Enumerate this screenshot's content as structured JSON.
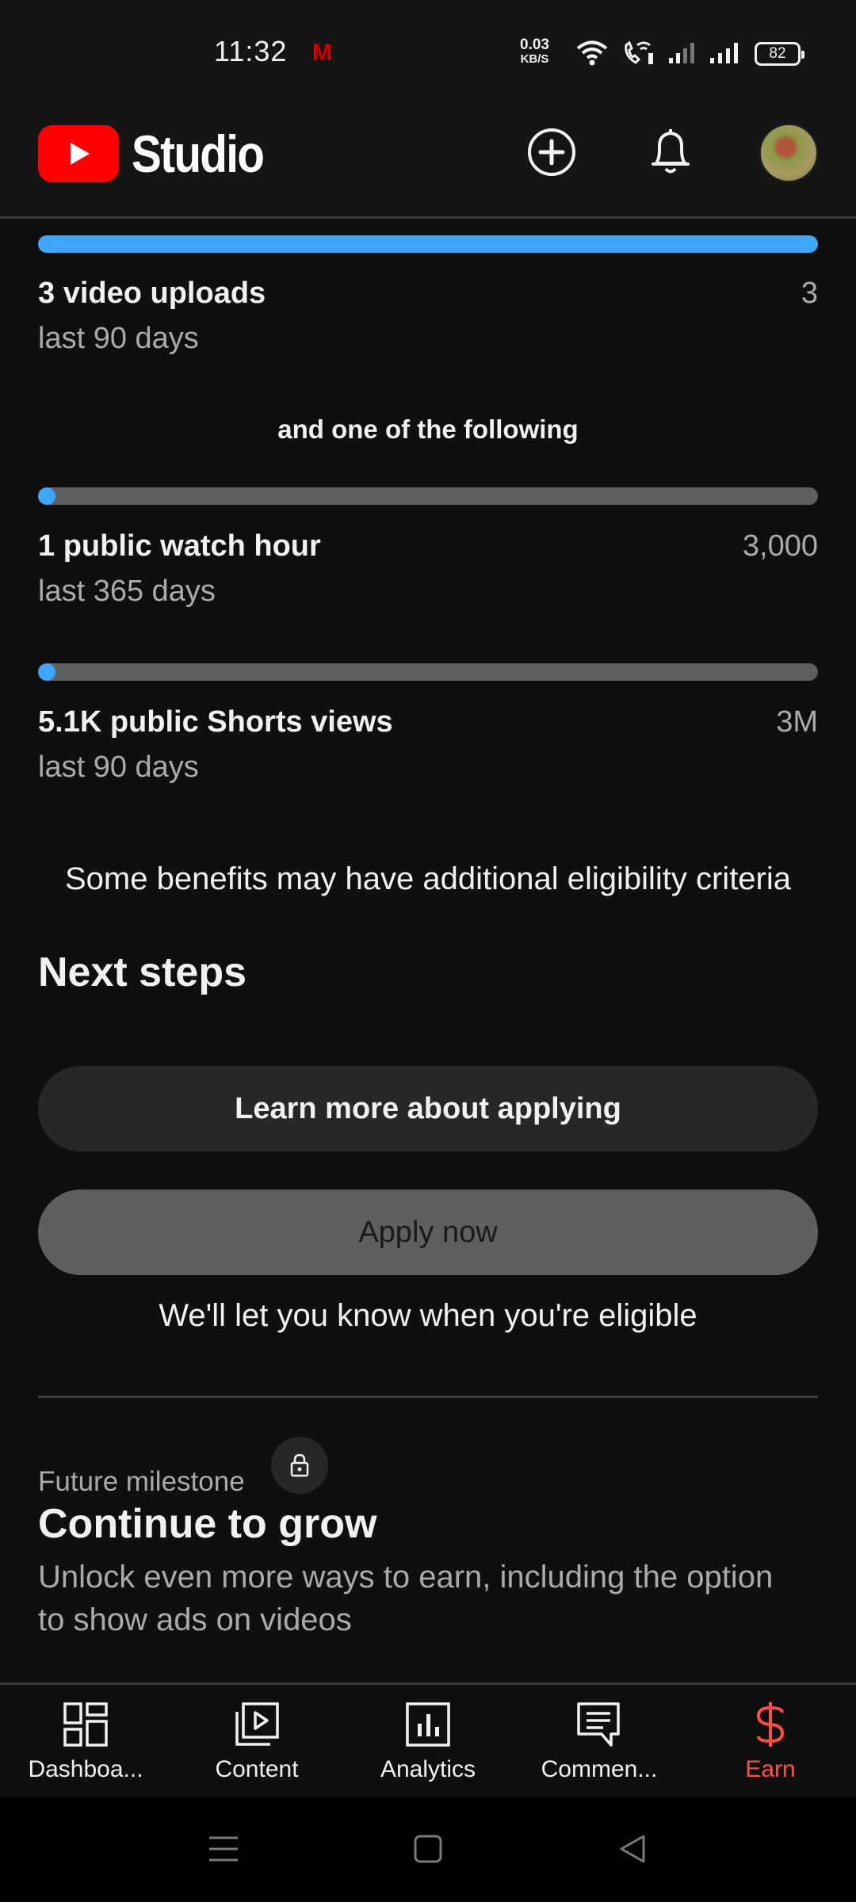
{
  "status_bar": {
    "time": "11:32",
    "gmail_icon_text": "M",
    "net_speed_value": "0.03",
    "net_speed_unit": "KB/S",
    "battery": "82"
  },
  "header": {
    "logo_text": "Studio"
  },
  "requirements": {
    "uploads": {
      "title": "3 video uploads",
      "subtitle": "last 90 days",
      "goal": "3",
      "progress": 1.0
    },
    "divider_text": "and one of the following",
    "watch_hours": {
      "title": "1 public watch hour",
      "subtitle": "last 365 days",
      "goal": "3,000",
      "progress": 0.0003
    },
    "shorts_views": {
      "title": "5.1K public Shorts views",
      "subtitle": "last 90 days",
      "goal": "3M",
      "progress": 0.0017
    }
  },
  "benefits_note": "Some benefits may have additional eligibility criteria",
  "next_steps": {
    "heading": "Next steps",
    "learn_button": "Learn more about applying",
    "apply_button": "Apply now",
    "eligibility_note": "We'll let you know when you're eligible"
  },
  "future_milestone": {
    "label": "Future milestone",
    "title": "Continue to grow",
    "description_line1": "Unlock even more ways to earn, including the option",
    "description_line2": "to show ads on videos"
  },
  "bottom_nav": {
    "items": [
      {
        "label": "Dashboa...",
        "icon": "dashboard-icon"
      },
      {
        "label": "Content",
        "icon": "content-icon"
      },
      {
        "label": "Analytics",
        "icon": "analytics-icon"
      },
      {
        "label": "Commen...",
        "icon": "comments-icon"
      },
      {
        "label": "Earn",
        "icon": "earn-icon"
      }
    ],
    "active": "Earn"
  },
  "colors": {
    "background": "#0f0f0f",
    "progress_fill": "#3ea6ff",
    "progress_track": "#5e5e5e",
    "brand_red": "#ff0000",
    "active_tab": "#ff4e45"
  }
}
